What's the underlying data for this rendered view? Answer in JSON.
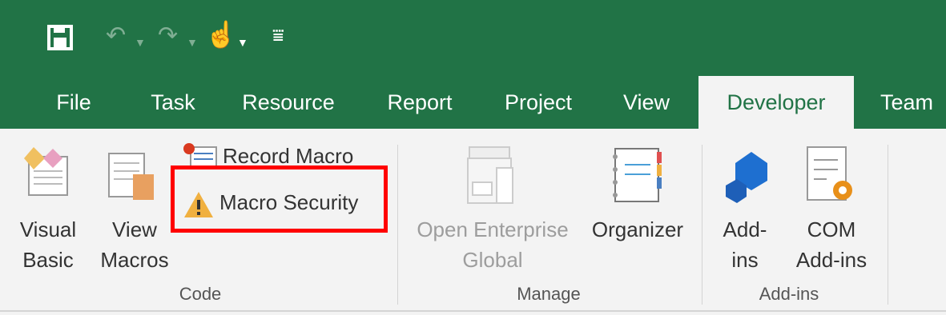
{
  "tabs": [
    "File",
    "Task",
    "Resource",
    "Report",
    "Project",
    "View",
    "Developer",
    "Team"
  ],
  "code_group": {
    "visual_basic": [
      "Visual",
      "Basic"
    ],
    "view_macros": [
      "View",
      "Macros"
    ],
    "record_macro": "Record Macro",
    "macro_security": "Macro Security",
    "label": "Code"
  },
  "manage_group": {
    "open_enterprise_global": [
      "Open Enterprise",
      "Global"
    ],
    "organizer": "Organizer",
    "label": "Manage"
  },
  "addins_group": {
    "add_ins": [
      "Add-",
      "ins"
    ],
    "com_add_ins": [
      "COM",
      "Add-ins"
    ],
    "label": "Add-ins"
  },
  "colors": {
    "accent": "#217346",
    "highlight": "#ff0000"
  }
}
